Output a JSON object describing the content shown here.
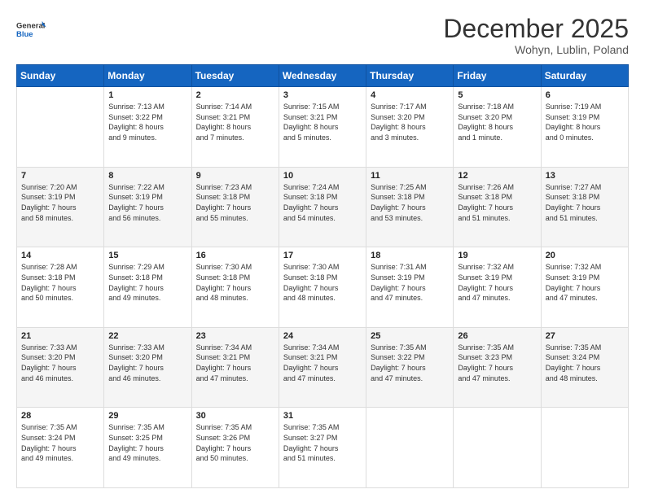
{
  "logo": {
    "line1": "General",
    "line2": "Blue"
  },
  "title": "December 2025",
  "location": "Wohyn, Lublin, Poland",
  "days_header": [
    "Sunday",
    "Monday",
    "Tuesday",
    "Wednesday",
    "Thursday",
    "Friday",
    "Saturday"
  ],
  "weeks": [
    [
      {
        "day": "",
        "info": ""
      },
      {
        "day": "1",
        "info": "Sunrise: 7:13 AM\nSunset: 3:22 PM\nDaylight: 8 hours\nand 9 minutes."
      },
      {
        "day": "2",
        "info": "Sunrise: 7:14 AM\nSunset: 3:21 PM\nDaylight: 8 hours\nand 7 minutes."
      },
      {
        "day": "3",
        "info": "Sunrise: 7:15 AM\nSunset: 3:21 PM\nDaylight: 8 hours\nand 5 minutes."
      },
      {
        "day": "4",
        "info": "Sunrise: 7:17 AM\nSunset: 3:20 PM\nDaylight: 8 hours\nand 3 minutes."
      },
      {
        "day": "5",
        "info": "Sunrise: 7:18 AM\nSunset: 3:20 PM\nDaylight: 8 hours\nand 1 minute."
      },
      {
        "day": "6",
        "info": "Sunrise: 7:19 AM\nSunset: 3:19 PM\nDaylight: 8 hours\nand 0 minutes."
      }
    ],
    [
      {
        "day": "7",
        "info": "Sunrise: 7:20 AM\nSunset: 3:19 PM\nDaylight: 7 hours\nand 58 minutes."
      },
      {
        "day": "8",
        "info": "Sunrise: 7:22 AM\nSunset: 3:19 PM\nDaylight: 7 hours\nand 56 minutes."
      },
      {
        "day": "9",
        "info": "Sunrise: 7:23 AM\nSunset: 3:18 PM\nDaylight: 7 hours\nand 55 minutes."
      },
      {
        "day": "10",
        "info": "Sunrise: 7:24 AM\nSunset: 3:18 PM\nDaylight: 7 hours\nand 54 minutes."
      },
      {
        "day": "11",
        "info": "Sunrise: 7:25 AM\nSunset: 3:18 PM\nDaylight: 7 hours\nand 53 minutes."
      },
      {
        "day": "12",
        "info": "Sunrise: 7:26 AM\nSunset: 3:18 PM\nDaylight: 7 hours\nand 51 minutes."
      },
      {
        "day": "13",
        "info": "Sunrise: 7:27 AM\nSunset: 3:18 PM\nDaylight: 7 hours\nand 51 minutes."
      }
    ],
    [
      {
        "day": "14",
        "info": "Sunrise: 7:28 AM\nSunset: 3:18 PM\nDaylight: 7 hours\nand 50 minutes."
      },
      {
        "day": "15",
        "info": "Sunrise: 7:29 AM\nSunset: 3:18 PM\nDaylight: 7 hours\nand 49 minutes."
      },
      {
        "day": "16",
        "info": "Sunrise: 7:30 AM\nSunset: 3:18 PM\nDaylight: 7 hours\nand 48 minutes."
      },
      {
        "day": "17",
        "info": "Sunrise: 7:30 AM\nSunset: 3:18 PM\nDaylight: 7 hours\nand 48 minutes."
      },
      {
        "day": "18",
        "info": "Sunrise: 7:31 AM\nSunset: 3:19 PM\nDaylight: 7 hours\nand 47 minutes."
      },
      {
        "day": "19",
        "info": "Sunrise: 7:32 AM\nSunset: 3:19 PM\nDaylight: 7 hours\nand 47 minutes."
      },
      {
        "day": "20",
        "info": "Sunrise: 7:32 AM\nSunset: 3:19 PM\nDaylight: 7 hours\nand 47 minutes."
      }
    ],
    [
      {
        "day": "21",
        "info": "Sunrise: 7:33 AM\nSunset: 3:20 PM\nDaylight: 7 hours\nand 46 minutes."
      },
      {
        "day": "22",
        "info": "Sunrise: 7:33 AM\nSunset: 3:20 PM\nDaylight: 7 hours\nand 46 minutes."
      },
      {
        "day": "23",
        "info": "Sunrise: 7:34 AM\nSunset: 3:21 PM\nDaylight: 7 hours\nand 47 minutes."
      },
      {
        "day": "24",
        "info": "Sunrise: 7:34 AM\nSunset: 3:21 PM\nDaylight: 7 hours\nand 47 minutes."
      },
      {
        "day": "25",
        "info": "Sunrise: 7:35 AM\nSunset: 3:22 PM\nDaylight: 7 hours\nand 47 minutes."
      },
      {
        "day": "26",
        "info": "Sunrise: 7:35 AM\nSunset: 3:23 PM\nDaylight: 7 hours\nand 47 minutes."
      },
      {
        "day": "27",
        "info": "Sunrise: 7:35 AM\nSunset: 3:24 PM\nDaylight: 7 hours\nand 48 minutes."
      }
    ],
    [
      {
        "day": "28",
        "info": "Sunrise: 7:35 AM\nSunset: 3:24 PM\nDaylight: 7 hours\nand 49 minutes."
      },
      {
        "day": "29",
        "info": "Sunrise: 7:35 AM\nSunset: 3:25 PM\nDaylight: 7 hours\nand 49 minutes."
      },
      {
        "day": "30",
        "info": "Sunrise: 7:35 AM\nSunset: 3:26 PM\nDaylight: 7 hours\nand 50 minutes."
      },
      {
        "day": "31",
        "info": "Sunrise: 7:35 AM\nSunset: 3:27 PM\nDaylight: 7 hours\nand 51 minutes."
      },
      {
        "day": "",
        "info": ""
      },
      {
        "day": "",
        "info": ""
      },
      {
        "day": "",
        "info": ""
      }
    ]
  ]
}
